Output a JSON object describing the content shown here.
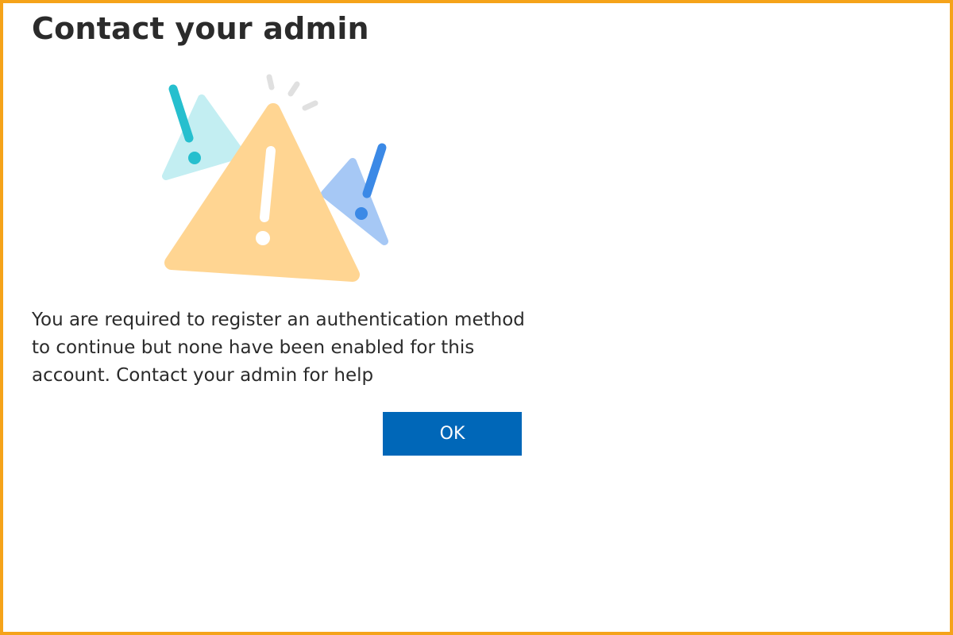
{
  "dialog": {
    "title": "Contact your admin",
    "message": "You are required to register an authentication method to continue but none have been enabled for this account. Contact your admin for help",
    "ok_label": "OK"
  },
  "icons": {
    "illustration": "warning-triangles-icon"
  },
  "colors": {
    "frame_border": "#f5a31a",
    "primary_button": "#0067b8",
    "main_triangle": "#ffd592",
    "teal_triangle": "#c3eef2",
    "teal_mark": "#26bfce",
    "blue_triangle": "#a6c8f5",
    "blue_mark": "#3b89e6"
  }
}
